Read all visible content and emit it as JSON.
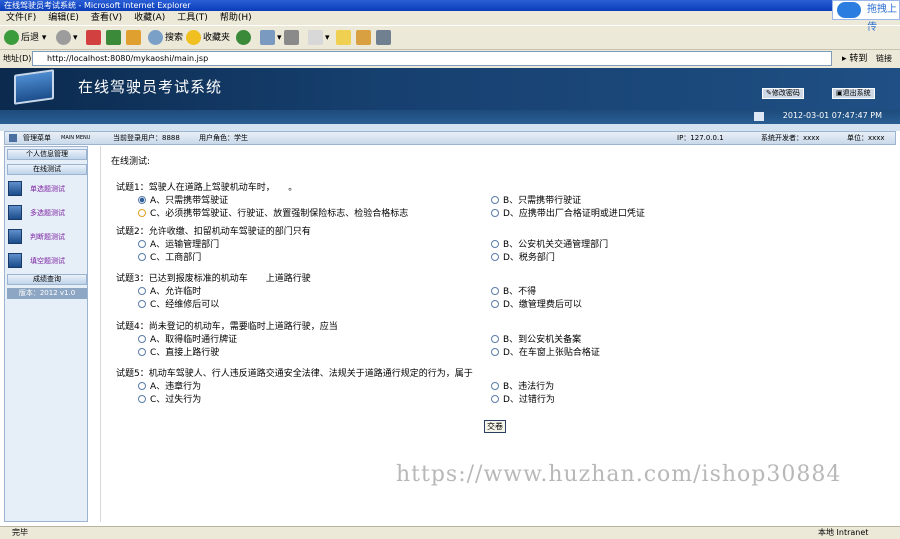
{
  "browser": {
    "window_title": "在线驾驶员考试系统 - Microsoft Internet Explorer",
    "menu": [
      "文件(F)",
      "编辑(E)",
      "查看(V)",
      "收藏(A)",
      "工具(T)",
      "帮助(H)"
    ],
    "toolbar": {
      "back": "后退",
      "search": "搜索",
      "favorites": "收藏夹"
    },
    "address_label": "地址(D)",
    "url": "http://localhost:8080/mykaoshi/main.jsp",
    "go": "转到",
    "links": "链接",
    "cloud_tab": "拖拽上传",
    "status": "完毕",
    "zone": "本地 Intranet"
  },
  "header": {
    "title": "在线驾驶员考试系统",
    "change_password": "修改密码",
    "logout": "退出系统",
    "datetime": "2012-03-01 07:47:47 PM"
  },
  "infobar": {
    "menu_label": "管理菜单",
    "menu_sub": "MAIN MENU",
    "current_user": "当前登录用户：8888",
    "user_role": "用户角色：学生",
    "ip": "IP：127.0.0.1",
    "developer": "系统开发者：xxxx",
    "unit": "单位：xxxx"
  },
  "sidebar": {
    "personal_info": "个人信息管理",
    "online_test": "在线测试",
    "items": [
      "单选题测试",
      "多选题测试",
      "判断题测试",
      "填空题测试"
    ],
    "score_query": "成绩查询",
    "version": "版本：2012 v1.0"
  },
  "content": {
    "section_title": "在线测试:",
    "questions": [
      {
        "text": "试题1：驾驶人在道路上驾驶机动车时，　　。",
        "options": [
          "A、只需携带驾驶证",
          "B、只需携带行驶证",
          "C、必须携带驾驶证、行驶证、放置强制保险标志、检验合格标志",
          "D、应携带出厂合格证明或进口凭证"
        ]
      },
      {
        "text": "试题2：允许收缴、扣留机动车驾驶证的部门只有",
        "options": [
          "A、运输管理部门",
          "B、公安机关交通管理部门",
          "C、工商部门",
          "D、税务部门"
        ]
      },
      {
        "text": "试题3：已达到报废标准的机动车　　上道路行驶",
        "options": [
          "A、允许临时",
          "B、不得",
          "C、经维修后可以",
          "D、缴管理费后可以"
        ]
      },
      {
        "text": "试题4：尚未登记的机动车，需要临时上道路行驶，应当",
        "options": [
          "A、取得临时通行牌证",
          "B、到公安机关备案",
          "C、直接上路行驶",
          "D、在车窗上张贴合格证"
        ]
      },
      {
        "text": "试题5：机动车驾驶人、行人违反道路交通安全法律、法规关于道路通行规定的行为，属于",
        "options": [
          "A、违章行为",
          "B、违法行为",
          "C、过失行为",
          "D、过错行为"
        ]
      }
    ],
    "submit": "交卷",
    "watermark": "https://www.huzhan.com/ishop30884"
  }
}
